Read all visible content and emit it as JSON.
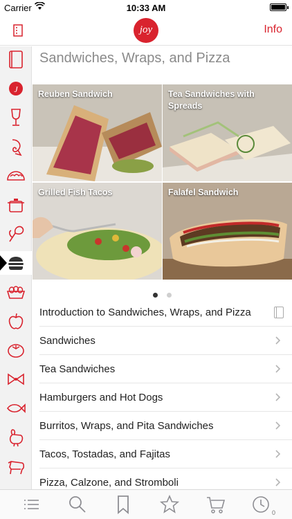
{
  "status_bar": {
    "carrier": "Carrier",
    "time": "10:33 AM"
  },
  "nav": {
    "logo_text": "joy",
    "info_label": "Info"
  },
  "sidebar": {
    "items": [
      {
        "name": "book-icon"
      },
      {
        "name": "joy-badge-icon"
      },
      {
        "name": "wine-glass-icon"
      },
      {
        "name": "shrimp-icon"
      },
      {
        "name": "taco-icon"
      },
      {
        "name": "pot-icon"
      },
      {
        "name": "vegetable-icon"
      },
      {
        "name": "burger-icon",
        "active": true
      },
      {
        "name": "eggs-icon"
      },
      {
        "name": "apple-icon"
      },
      {
        "name": "tomato-icon"
      },
      {
        "name": "pasta-icon"
      },
      {
        "name": "fish-icon"
      },
      {
        "name": "chicken-icon"
      },
      {
        "name": "cow-icon"
      }
    ]
  },
  "main": {
    "title": "Sandwiches, Wraps, and Pizza",
    "featured": [
      {
        "caption": "Reuben Sandwich"
      },
      {
        "caption": "Tea Sandwiches with Spreads"
      },
      {
        "caption": "Grilled Fish Tacos"
      },
      {
        "caption": "Falafel Sandwich"
      }
    ],
    "pager": {
      "pages": 2,
      "current": 1
    },
    "list": [
      {
        "label": "Introduction to Sandwiches, Wraps, and Pizza",
        "accessory": "book"
      },
      {
        "label": "Sandwiches",
        "accessory": "chevron"
      },
      {
        "label": "Tea Sandwiches",
        "accessory": "chevron"
      },
      {
        "label": "Hamburgers and Hot Dogs",
        "accessory": "chevron"
      },
      {
        "label": "Burritos, Wraps, and Pita Sandwiches",
        "accessory": "chevron"
      },
      {
        "label": "Tacos, Tostadas, and Fajitas",
        "accessory": "chevron"
      },
      {
        "label": "Pizza, Calzone, and Stromboli",
        "accessory": "chevron"
      }
    ]
  },
  "tabbar": {
    "items": [
      {
        "name": "list-icon"
      },
      {
        "name": "search-icon"
      },
      {
        "name": "bookmark-icon"
      },
      {
        "name": "star-icon"
      },
      {
        "name": "cart-icon"
      },
      {
        "name": "history-icon",
        "badge": "0"
      }
    ]
  },
  "colors": {
    "accent": "#d9232e",
    "icon_gray": "#8e8e93"
  }
}
